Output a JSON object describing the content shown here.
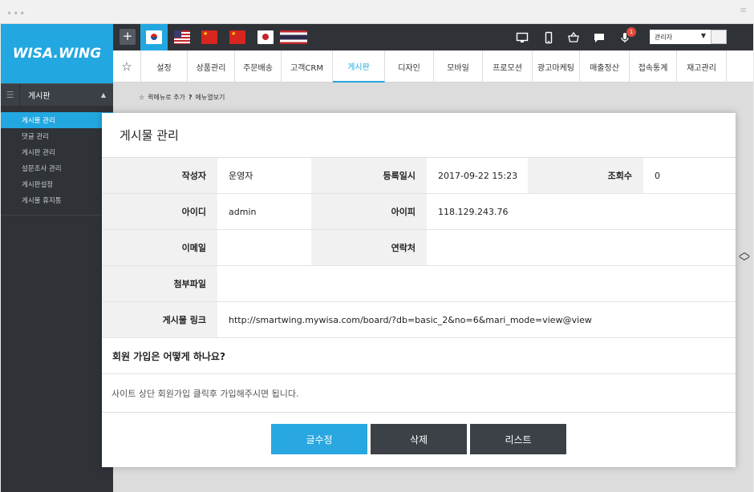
{
  "window": {
    "dots": "•••",
    "menu_icon": "≡"
  },
  "logo": "WISA.WING",
  "sidebar": {
    "section_label": "게시판",
    "items": [
      {
        "label": "게시물 관리",
        "active": true
      },
      {
        "label": "댓글 관리",
        "active": false
      },
      {
        "label": "게시판 관리",
        "active": false
      },
      {
        "label": "설문조사 관리",
        "active": false
      },
      {
        "label": "게시판설정",
        "active": false
      },
      {
        "label": "게시물 휴지통",
        "active": false
      }
    ]
  },
  "topbar": {
    "plus": "+",
    "flags": [
      "kr",
      "us",
      "cn",
      "cn",
      "jp",
      "th"
    ],
    "notification_count": "1",
    "user_role": "관리자"
  },
  "nav": {
    "tabs": [
      "설정",
      "상품관리",
      "주문배송",
      "고객CRM",
      "게시판",
      "디자인",
      "모바일",
      "프로모션",
      "광고마케팅",
      "매출정산",
      "접속통계",
      "재고관리"
    ],
    "selected": "게시판"
  },
  "subbar": {
    "quick_add": "퀵메뉴로 추가",
    "help": "메뉴열보기"
  },
  "modal": {
    "title": "게시물 관리",
    "fields": {
      "author_label": "작성자",
      "author": "운영자",
      "date_label": "등록일시",
      "date": "2017-09-22 15:23",
      "views_label": "조회수",
      "views": "0",
      "id_label": "아이디",
      "id": "admin",
      "ip_label": "아이피",
      "ip": "118.129.243.76",
      "email_label": "이메일",
      "email": "",
      "phone_label": "연락처",
      "phone": "",
      "attach_label": "첨부파일",
      "attach": "",
      "link_label": "게시물 링크",
      "link": "http://smartwing.mywisa.com/board/?db=basic_2&no=6&mari_mode=view@view"
    },
    "question": "회원 가입은 어떻게 하나요?",
    "answer": "사이트 상단 회원가입 클릭후 가입해주시면 됩니다.",
    "buttons": {
      "edit": "글수정",
      "delete": "삭제",
      "list": "리스트"
    }
  }
}
